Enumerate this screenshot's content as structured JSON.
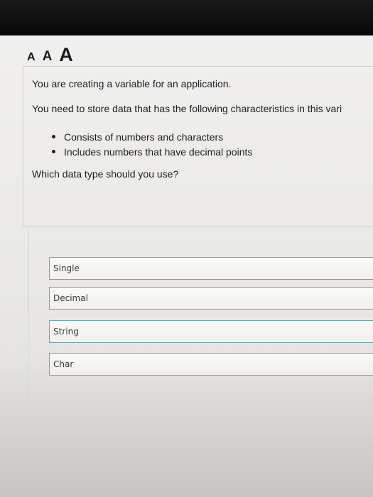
{
  "font_size_controls": {
    "small": "A",
    "medium": "A",
    "large": "A"
  },
  "question": {
    "line1": "You are creating a variable for an application.",
    "line2": "You need to store data that has the following characteristics in this vari",
    "bullets": [
      "Consists of numbers and characters",
      "Includes numbers that have decimal points"
    ],
    "prompt": "Which data type should you use?"
  },
  "answers": [
    "Single",
    "Decimal",
    "String",
    "Char"
  ],
  "colors": {
    "answer_border": "#6fa6a6",
    "text": "#1f1f1f",
    "bezel": "#0d0d0d"
  }
}
